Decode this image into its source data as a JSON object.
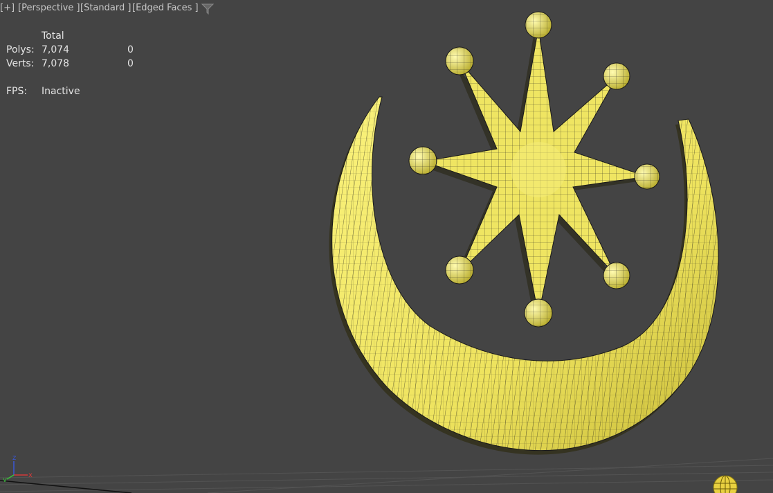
{
  "viewport": {
    "labels": {
      "plus": "[+]",
      "view": "[Perspective ]",
      "shading": "[Standard ]",
      "edges": "[Edged Faces ]"
    },
    "filter_icon": "funnel-filter-icon"
  },
  "stats": {
    "header": "Total",
    "polys_label": "Polys:",
    "polys_total": "7,074",
    "polys_selected": "0",
    "verts_label": "Verts:",
    "verts_total": "7,078",
    "verts_selected": "0",
    "fps_label": "FPS:",
    "fps_value": "Inactive"
  },
  "scene": {
    "object": "crescent-and-star-mesh",
    "mesh_color": "#f2ea6a",
    "wire_color": "#1a1a1a",
    "background": "#444444"
  },
  "gizmos": {
    "axis": {
      "x": "x",
      "y": "y",
      "z": "z"
    },
    "nav": "viewcube-globe-icon"
  }
}
